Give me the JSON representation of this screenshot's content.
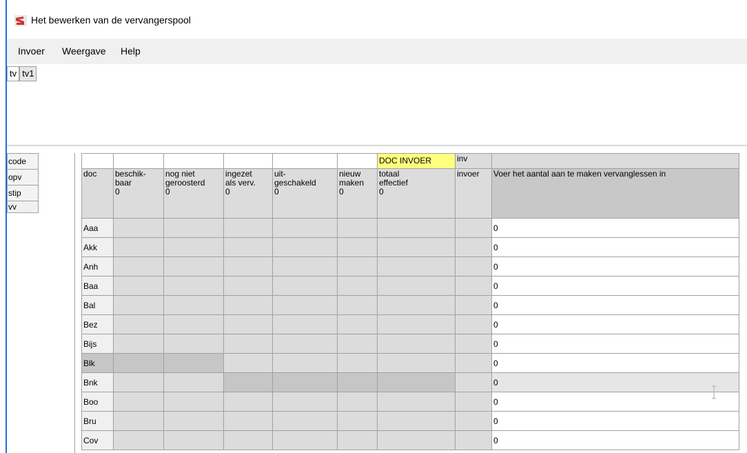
{
  "window": {
    "title": "Het bewerken van de vervangerspool",
    "icon": "app-logo-icon"
  },
  "menu": {
    "items": [
      "Invoer",
      "Weergave",
      "Help"
    ]
  },
  "tabs": [
    "tv",
    "tv1"
  ],
  "sidebar": {
    "items": [
      "code",
      "opv",
      "stip",
      "vv"
    ]
  },
  "table": {
    "top_row": [
      "",
      "",
      "",
      "",
      "",
      "",
      "DOC INVOER",
      "inv",
      ""
    ],
    "headers": [
      [
        "doc"
      ],
      [
        "beschik-",
        "baar",
        "0"
      ],
      [
        "nog niet",
        "geroosterd",
        "0"
      ],
      [
        "ingezet",
        "als verv.",
        "0"
      ],
      [
        "uit-",
        "geschakeld",
        "0"
      ],
      [
        "nieuw",
        "maken",
        "0"
      ],
      [
        "totaal",
        "effectief",
        "0"
      ],
      [
        "invoer"
      ],
      [
        "Voer het aantal aan te maken vervanglessen in"
      ]
    ],
    "rows": [
      {
        "doc": "Aaa",
        "value": "0"
      },
      {
        "doc": "Akk",
        "value": "0"
      },
      {
        "doc": "Anh",
        "value": "0"
      },
      {
        "doc": "Baa",
        "value": "0"
      },
      {
        "doc": "Bal",
        "value": "0"
      },
      {
        "doc": "Bez",
        "value": "0"
      },
      {
        "doc": "Bijs",
        "value": "0"
      },
      {
        "doc": "Blk",
        "value": "0"
      },
      {
        "doc": "Bnk",
        "value": "0"
      },
      {
        "doc": "Boo",
        "value": "0"
      },
      {
        "doc": "Bru",
        "value": "0"
      },
      {
        "doc": "Cov",
        "value": "0"
      }
    ]
  },
  "colors": {
    "accent": "#1f6fd1",
    "highlight": "#ffff80",
    "cell_gray": "#dcdcdc"
  }
}
